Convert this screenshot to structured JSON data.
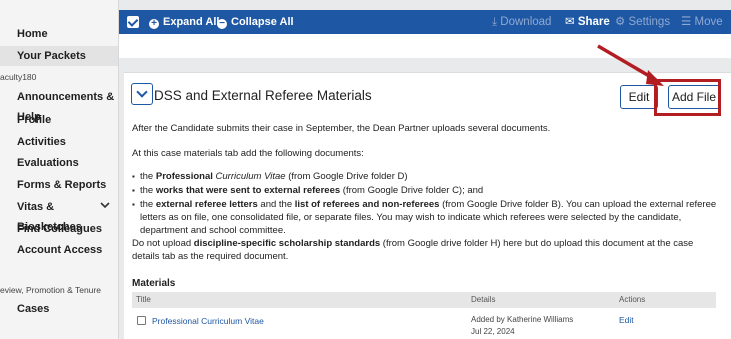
{
  "sidebar": {
    "items": [
      {
        "label": "Home"
      },
      {
        "label": "Your Packets"
      }
    ],
    "section1": "aculty180",
    "items2": [
      {
        "label": "Announcements & Help"
      },
      {
        "label": "Profile"
      },
      {
        "label": "Activities"
      },
      {
        "label": "Evaluations"
      },
      {
        "label": "Forms & Reports"
      },
      {
        "label": "Vitas & Biosketches"
      },
      {
        "label": "Find Colleagues"
      },
      {
        "label": "Account Access"
      }
    ],
    "section2": "eview, Promotion & Tenure",
    "items3": [
      {
        "label": "Cases"
      }
    ],
    "chevron": "chevron-down-icon"
  },
  "toolbar": {
    "expand_label": "Expand All",
    "collapse_label": "Collapse All",
    "download_label": "Download",
    "share_label": "Share",
    "settings_label": "Settings",
    "move_label": "Move",
    "colors": {
      "bar": "#1e57a4",
      "dim": "#8fa9d3"
    }
  },
  "card": {
    "title": "DSS and External Referee Materials",
    "edit_label": "Edit",
    "add_file_label": "Add File",
    "intro": "After the Candidate submits their case in September, the Dean Partner uploads several documents.",
    "instructions": "At this case materials tab add the following documents:",
    "bullets": [
      {
        "a": "the ",
        "b": "Professional ",
        "c": "Curriculum Vitae",
        "d": " (from Google Drive folder D)"
      },
      {
        "a": "the ",
        "b": "works that were sent to external referees",
        "c": "",
        "d": " (from Google Drive folder C); and"
      },
      {
        "a": "the ",
        "b": "external referee letters",
        "c": "",
        "d": " and the ",
        "e": "list of referees and non-referees",
        "f": " (from Google Drive folder B).  You can upload the external referee letters as on file, one consolidated file, or separate files.  You may wish to indicate which referees were selected by the candidate, department and school committee."
      }
    ],
    "note_pre": "Do not upload ",
    "note_bold": "discipline-specific scholarship standards",
    "note_post": " (from Google drive folder H) here but do upload this document at the case details tab as the required document.",
    "materials_heading": "Materials",
    "table_headers": [
      "Title",
      "Details",
      "Actions"
    ],
    "rows": [
      {
        "title": "Professional Curriculum Vitae",
        "details": "Added by Katherine Williams",
        "date": "Jul 22, 2024",
        "action": "Edit"
      }
    ]
  },
  "annotation": {
    "color": "#b21d22"
  }
}
